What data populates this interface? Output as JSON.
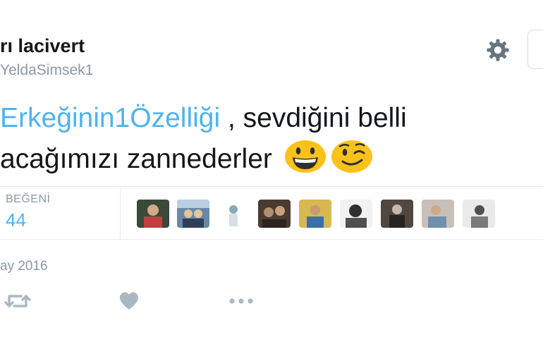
{
  "tweet": {
    "display_name": "rı lacivert",
    "handle": "YeldaSimsek1",
    "text": {
      "hashtag": "Erkeğinin1Özelliği",
      "line1_rest": " , sevdiğini belli",
      "line2": "acağımızı zannederler"
    },
    "emojis": [
      "grinning-face",
      "winking-face"
    ],
    "likes_label": "BEĞENİ",
    "likes_count": "44",
    "liker_avatars": [
      {
        "name": "avatar-1",
        "colors": [
          "#3a4a3a",
          "#c04040"
        ]
      },
      {
        "name": "avatar-2",
        "colors": [
          "#6a88a8",
          "#e4c49a"
        ]
      },
      {
        "name": "avatar-3",
        "colors": [
          "#d8e0e6",
          "#8aa8b8"
        ]
      },
      {
        "name": "avatar-4",
        "colors": [
          "#4a3a30",
          "#b09070"
        ]
      },
      {
        "name": "avatar-5",
        "colors": [
          "#d8b850",
          "#3a70a8"
        ]
      },
      {
        "name": "avatar-6",
        "colors": [
          "#f2f2f2",
          "#303030"
        ]
      },
      {
        "name": "avatar-7",
        "colors": [
          "#504840",
          "#c8b8a8"
        ]
      },
      {
        "name": "avatar-8",
        "colors": [
          "#c8c0b8",
          "#7090b0"
        ]
      },
      {
        "name": "avatar-9",
        "colors": [
          "#eaeaea",
          "#505050"
        ]
      }
    ],
    "date": "ay 2016"
  },
  "colors": {
    "accent": "#4fb3ee",
    "muted": "#8899a6",
    "icon": "#aab8c2",
    "emoji": "#fcc21b"
  },
  "icons": [
    "gear-icon",
    "retweet-icon",
    "heart-icon",
    "more-icon"
  ]
}
